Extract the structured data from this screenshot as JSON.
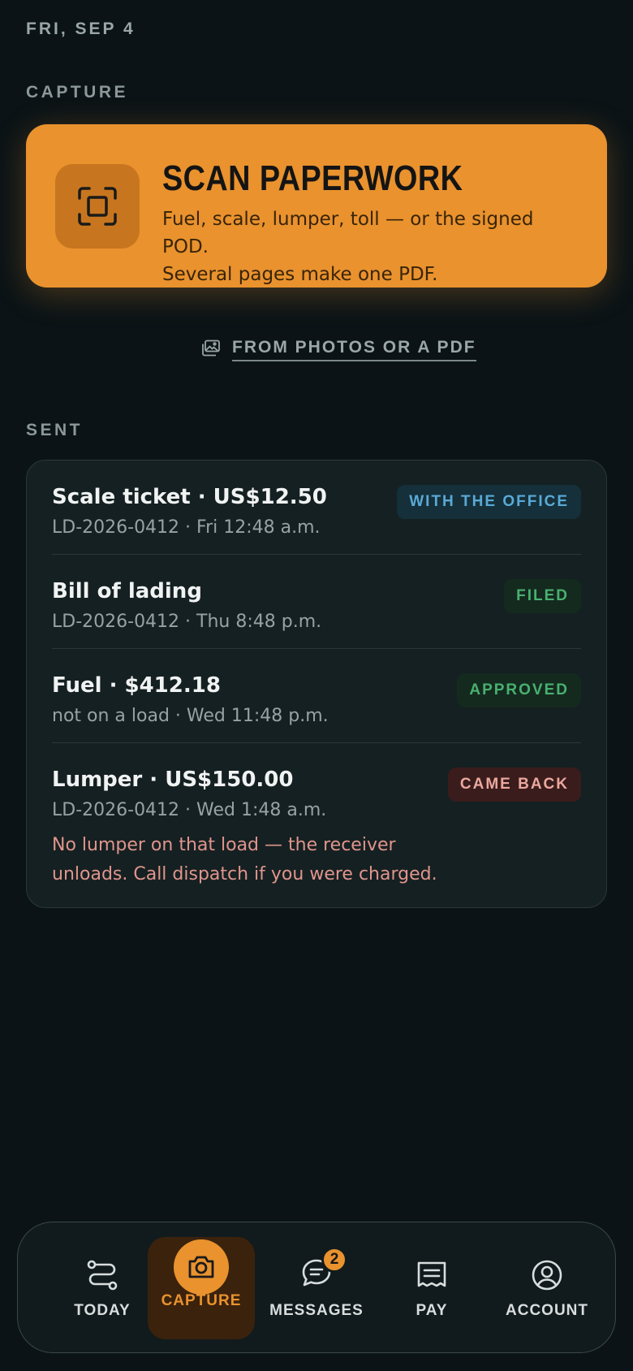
{
  "header": {
    "date": "FRI, SEP 4"
  },
  "capture": {
    "section_label": "CAPTURE",
    "scan_title": "SCAN PAPERWORK",
    "scan_line1": "Fuel, scale, lumper, toll — or the signed POD.",
    "scan_line2": "Several pages make one PDF.",
    "from_photos": "FROM PHOTOS OR A PDF"
  },
  "sent": {
    "section_label": "SENT",
    "items": [
      {
        "title": "Scale ticket · US$12.50",
        "sub": "LD-2026-0412 · Fri 12:48 a.m.",
        "status": "WITH THE OFFICE",
        "status_color": "#5aa9d6"
      },
      {
        "title": "Bill of lading",
        "sub": "LD-2026-0412 · Thu 8:48 p.m.",
        "status": "FILED",
        "status_color": "#49b06f"
      },
      {
        "title": "Fuel · $412.18",
        "sub": "not on a load · Wed 11:48 p.m.",
        "status": "APPROVED",
        "status_color": "#49b06f"
      },
      {
        "title": "Lumper · US$150.00",
        "sub": "LD-2026-0412 · Wed 1:48 a.m.",
        "status": "CAME BACK",
        "status_color": "#eba89e",
        "note": "No lumper on that load — the receiver unloads. Call dispatch if you were charged."
      }
    ]
  },
  "nav": {
    "items": [
      {
        "label": "TODAY",
        "icon": "route-icon"
      },
      {
        "label": "CAPTURE",
        "icon": "camera-icon",
        "active": true
      },
      {
        "label": "MESSAGES",
        "icon": "chat-icon",
        "badge": "2"
      },
      {
        "label": "PAY",
        "icon": "receipt-icon"
      },
      {
        "label": "ACCOUNT",
        "icon": "user-icon"
      }
    ]
  },
  "colors": {
    "accent": "#e9922e",
    "background": "#0b1316",
    "card": "#152022"
  }
}
